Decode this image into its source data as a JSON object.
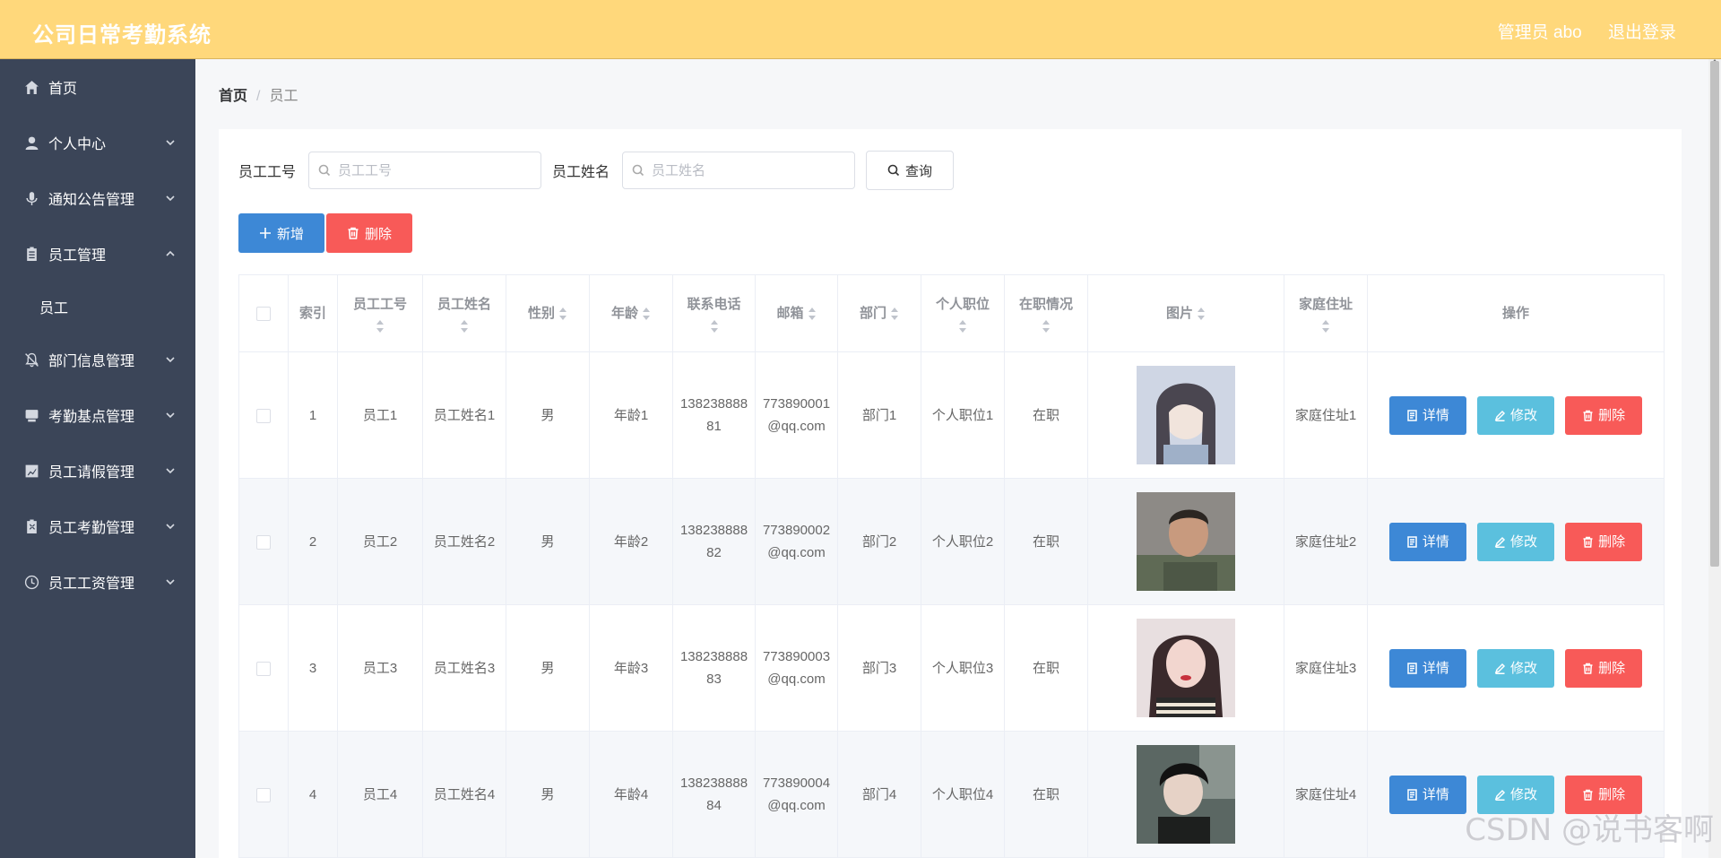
{
  "header": {
    "title": "公司日常考勤系统",
    "user": "管理员 abo",
    "logout": "退出登录"
  },
  "sidebar": {
    "items": [
      {
        "label": "首页",
        "icon": "home-icon",
        "expandable": false
      },
      {
        "label": "个人中心",
        "icon": "user-icon",
        "expandable": true
      },
      {
        "label": "通知公告管理",
        "icon": "microphone-icon",
        "expandable": true
      },
      {
        "label": "员工管理",
        "icon": "clipboard-icon",
        "expandable": true,
        "expanded": true,
        "children": [
          "员工"
        ]
      },
      {
        "label": "部门信息管理",
        "icon": "bell-off-icon",
        "expandable": true
      },
      {
        "label": "考勤基点管理",
        "icon": "monitor-icon",
        "expandable": true
      },
      {
        "label": "员工请假管理",
        "icon": "chart-icon",
        "expandable": true
      },
      {
        "label": "员工考勤管理",
        "icon": "checklist-icon",
        "expandable": true
      },
      {
        "label": "员工工资管理",
        "icon": "clock-icon",
        "expandable": true
      }
    ]
  },
  "breadcrumb": {
    "home": "首页",
    "separator": "/",
    "current": "员工"
  },
  "search": {
    "id_label": "员工工号",
    "id_placeholder": "员工工号",
    "name_label": "员工姓名",
    "name_placeholder": "员工姓名",
    "query_button": "查询"
  },
  "actions": {
    "add": "新增",
    "delete": "删除"
  },
  "table": {
    "columns": [
      "索引",
      "员工工号",
      "员工姓名",
      "性别",
      "年龄",
      "联系电话",
      "邮箱",
      "部门",
      "个人职位",
      "在职情况",
      "图片",
      "家庭住址",
      "操作"
    ],
    "rows": [
      {
        "index": "1",
        "emp_id": "员工1",
        "name": "员工姓名1",
        "gender": "男",
        "age": "年龄1",
        "phone": "13823888881",
        "email": "773890001@qq.com",
        "dept": "部门1",
        "position": "个人职位1",
        "status": "在职",
        "address": "家庭住址1"
      },
      {
        "index": "2",
        "emp_id": "员工2",
        "name": "员工姓名2",
        "gender": "男",
        "age": "年龄2",
        "phone": "13823888882",
        "email": "773890002@qq.com",
        "dept": "部门2",
        "position": "个人职位2",
        "status": "在职",
        "address": "家庭住址2"
      },
      {
        "index": "3",
        "emp_id": "员工3",
        "name": "员工姓名3",
        "gender": "男",
        "age": "年龄3",
        "phone": "13823888883",
        "email": "773890003@qq.com",
        "dept": "部门3",
        "position": "个人职位3",
        "status": "在职",
        "address": "家庭住址3"
      },
      {
        "index": "4",
        "emp_id": "员工4",
        "name": "员工姓名4",
        "gender": "男",
        "age": "年龄4",
        "phone": "13823888884",
        "email": "773890004@qq.com",
        "dept": "部门4",
        "position": "个人职位4",
        "status": "在职",
        "address": "家庭住址4"
      }
    ],
    "row_actions": {
      "detail": "详情",
      "edit": "修改",
      "delete": "删除"
    }
  },
  "watermark": "CSDN @说书客啊",
  "colors": {
    "header": "#ffd87b",
    "sidebar": "#3b4558",
    "primary": "#3d88d6",
    "info": "#5bc0de",
    "danger": "#f85a58"
  }
}
